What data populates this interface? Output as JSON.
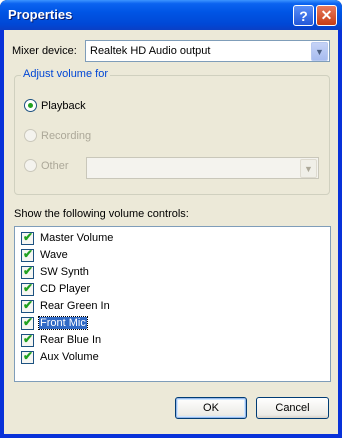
{
  "window": {
    "title": "Properties",
    "help_glyph": "?",
    "close_glyph": "✕"
  },
  "mixer": {
    "label": "Mixer device:",
    "value": "Realtek HD Audio output"
  },
  "adjust": {
    "title": "Adjust volume for",
    "options": [
      {
        "label": "Playback",
        "checked": true,
        "enabled": true
      },
      {
        "label": "Recording",
        "checked": false,
        "enabled": false
      },
      {
        "label": "Other",
        "checked": false,
        "enabled": false
      }
    ],
    "other_value": ""
  },
  "controls": {
    "label": "Show the following volume controls:",
    "items": [
      {
        "label": "Master Volume",
        "checked": true
      },
      {
        "label": "Wave",
        "checked": true
      },
      {
        "label": "SW Synth",
        "checked": true
      },
      {
        "label": "CD Player",
        "checked": true
      },
      {
        "label": "Rear Green In",
        "checked": true
      },
      {
        "label": "Front Mic",
        "checked": true,
        "selected": true
      },
      {
        "label": "Rear Blue In",
        "checked": true
      },
      {
        "label": "Aux Volume",
        "checked": true
      }
    ]
  },
  "buttons": {
    "ok": "OK",
    "cancel": "Cancel"
  },
  "colors": {
    "title_bar": "#0055E5",
    "face": "#ECE9D8",
    "group_title": "#0046D5",
    "selection": "#316AC5",
    "check": "#21A121"
  }
}
